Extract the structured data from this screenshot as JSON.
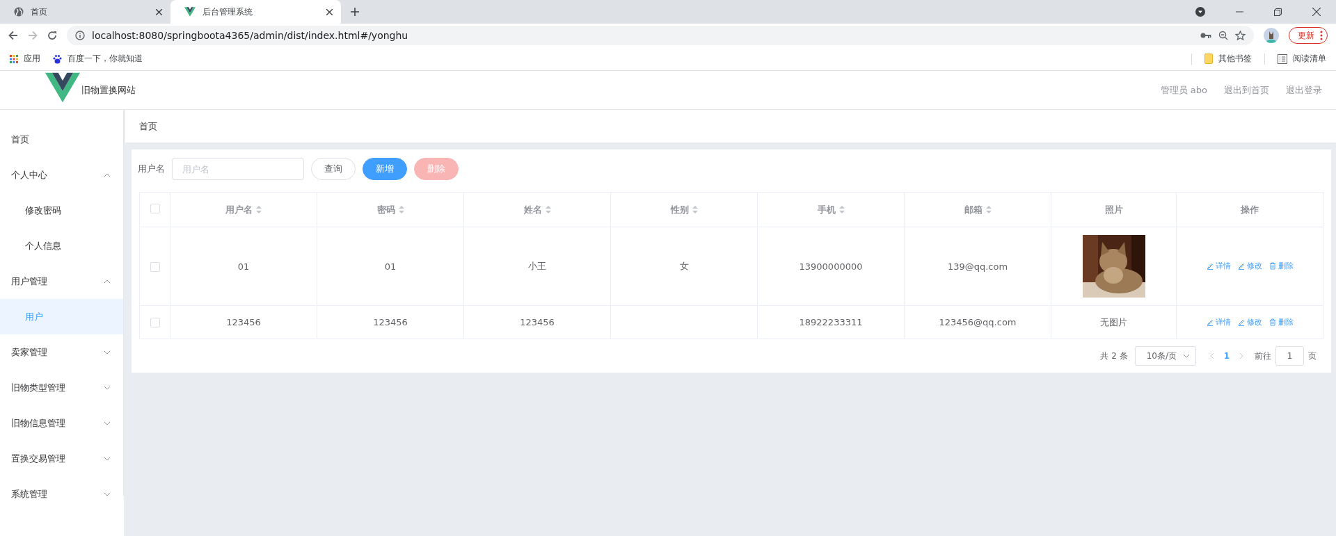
{
  "browser": {
    "tabs": [
      {
        "title": "首页",
        "kind": "globe",
        "selected": false
      },
      {
        "title": "后台管理系统",
        "kind": "vue",
        "selected": true
      }
    ],
    "url": "localhost:8080/springboota4365/admin/dist/index.html#/yonghu",
    "update_label": "更新",
    "bookmarks": [
      {
        "label": "应用",
        "kind": "apps"
      },
      {
        "label": "百度一下，你就知道",
        "kind": "paw"
      }
    ],
    "right_bookmarks": [
      {
        "label": "其他书签",
        "kind": "folder"
      },
      {
        "label": "阅读清单",
        "kind": "list"
      }
    ]
  },
  "header": {
    "site_name": "旧物置换网站",
    "user": "管理员 abo",
    "links": [
      "退出到首页",
      "退出登录"
    ]
  },
  "sidebar": {
    "items": [
      {
        "label": "首页",
        "selected": false
      },
      {
        "label": "个人中心",
        "selected": false,
        "expanded": true,
        "children": [
          {
            "label": "修改密码",
            "selected": false
          },
          {
            "label": "个人信息",
            "selected": false
          }
        ]
      },
      {
        "label": "用户管理",
        "selected": false,
        "expanded": true,
        "children": [
          {
            "label": "用户",
            "selected": true
          }
        ]
      },
      {
        "label": "卖家管理",
        "selected": false,
        "expanded": false
      },
      {
        "label": "旧物类型管理",
        "selected": false,
        "expanded": false
      },
      {
        "label": "旧物信息管理",
        "selected": false,
        "expanded": false
      },
      {
        "label": "置换交易管理",
        "selected": false,
        "expanded": false
      },
      {
        "label": "系统管理",
        "selected": false,
        "expanded": false
      }
    ]
  },
  "breadcrumb": "首页",
  "search": {
    "label": "用户名",
    "placeholder": "用户名",
    "buttons": [
      {
        "label": "查询",
        "kind": "default",
        "disabled": false
      },
      {
        "label": "新增",
        "kind": "primary",
        "disabled": false
      },
      {
        "label": "删除",
        "kind": "danger",
        "disabled": true
      }
    ]
  },
  "table": {
    "all_checked": false,
    "columns": [
      {
        "label": "用户名",
        "sortable": true
      },
      {
        "label": "密码",
        "sortable": true
      },
      {
        "label": "姓名",
        "sortable": true
      },
      {
        "label": "性别",
        "sortable": true
      },
      {
        "label": "手机",
        "sortable": true
      },
      {
        "label": "邮箱",
        "sortable": true
      },
      {
        "label": "照片",
        "sortable": false
      },
      {
        "label": "操作",
        "sortable": false
      }
    ],
    "rows": [
      {
        "checked": false,
        "cells": [
          "01",
          "01",
          "小王",
          "女",
          "13900000000",
          "139@qq.com"
        ],
        "actions": [
          {
            "label": "详情",
            "kind": "view"
          },
          {
            "label": "修改",
            "kind": "edit"
          },
          {
            "label": "删除",
            "kind": "delete"
          }
        ]
      },
      {
        "checked": false,
        "cells": [
          "123456",
          "123456",
          "123456",
          null,
          "18922233311",
          "123456@qq.com"
        ],
        "photo": {
          "kind": "text",
          "text": "无图片"
        },
        "actions": [
          {
            "label": "详情",
            "kind": "view"
          },
          {
            "label": "修改",
            "kind": "edit"
          },
          {
            "label": "删除",
            "kind": "delete"
          }
        ]
      }
    ]
  },
  "pagination": {
    "total": "共 2 条",
    "page_size": "10条/页",
    "pages": [
      {
        "label": "1",
        "selected": true
      }
    ],
    "goto_label": "前往",
    "goto_value": "1",
    "page_suffix": "页"
  }
}
